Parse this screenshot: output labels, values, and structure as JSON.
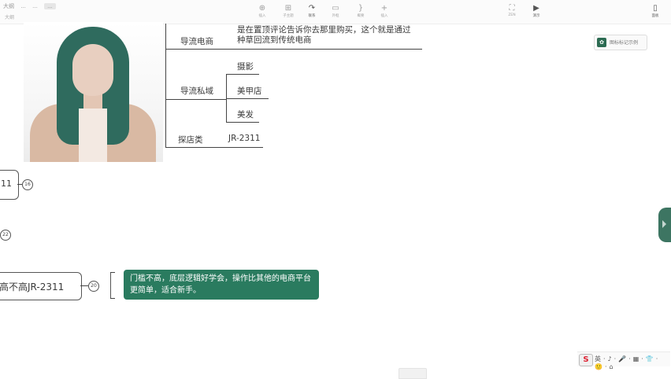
{
  "topbar": {
    "crumbs": [
      "大纲",
      "...",
      "...",
      "..."
    ],
    "doc_title": "大纲",
    "tools": [
      {
        "icon": "insert-topic-icon",
        "label": "插入"
      },
      {
        "icon": "subtopic-icon",
        "label": "子主题"
      },
      {
        "icon": "connect-icon",
        "label": "联系"
      },
      {
        "icon": "frame-icon",
        "label": "外框"
      },
      {
        "icon": "summary-icon",
        "label": "概要"
      },
      {
        "icon": "plus-icon",
        "label": "插入"
      },
      {
        "icon": "zen-icon",
        "label": "ZEN"
      },
      {
        "icon": "play-icon",
        "label": "演示"
      },
      {
        "icon": "panel-icon",
        "label": "面板"
      }
    ]
  },
  "mindmap": {
    "branch_ecommerce": "导流电商",
    "ecommerce_note_line1": "是在置顶评论告诉你去那里购买，这个就是通过",
    "ecommerce_note_line2": "种草回流到传统电商",
    "branch_private": "导流私域",
    "private_items": [
      "摄影",
      "美甲店",
      "美发"
    ],
    "branch_shop": "探店类",
    "shop_value": "JR-2311",
    "left_node_1": "11",
    "left_count_1": "16",
    "left_count_2": "22",
    "left_node_3": "高不高JR-2311",
    "left_count_3": "20",
    "note_text": "门槛不高，底层逻辑好学会，操作比其他的电商平台更简单，适合新手。"
  },
  "badge": {
    "label": "图标标记示例"
  },
  "ime": {
    "logo": "S",
    "items": "英·♪·🎤·▦·👕·🙂·⌂"
  },
  "colors": {
    "accent": "#2a7b5f",
    "hair": "#2f6b5e"
  }
}
